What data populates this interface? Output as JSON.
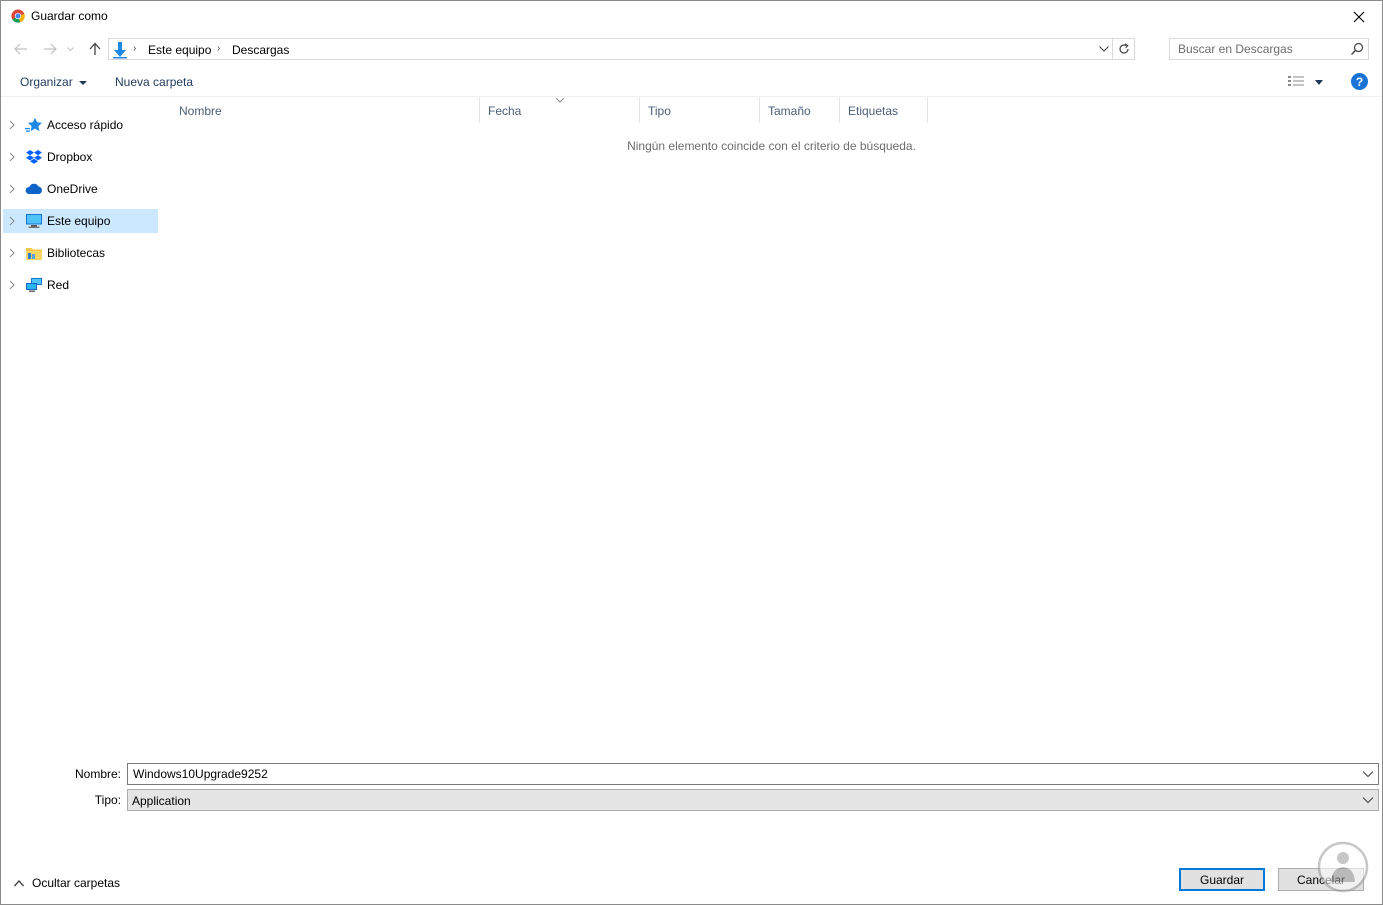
{
  "window": {
    "title": "Guardar como"
  },
  "address_bar": {
    "breadcrumbs": [
      "Este equipo",
      "Descargas"
    ]
  },
  "search": {
    "placeholder": "Buscar en Descargas"
  },
  "toolbar": {
    "organize_label": "Organizar",
    "new_folder_label": "Nueva carpeta"
  },
  "sidebar": {
    "items": [
      {
        "label": "Acceso rápido",
        "icon": "star-icon",
        "selected": false
      },
      {
        "label": "Dropbox",
        "icon": "dropbox-icon",
        "selected": false
      },
      {
        "label": "OneDrive",
        "icon": "cloud-icon",
        "selected": false
      },
      {
        "label": "Este equipo",
        "icon": "computer-icon",
        "selected": true
      },
      {
        "label": "Bibliotecas",
        "icon": "library-folder-icon",
        "selected": false
      },
      {
        "label": "Red",
        "icon": "network-icon",
        "selected": false
      }
    ]
  },
  "file_list": {
    "columns": [
      "Nombre",
      "Fecha",
      "Tipo",
      "Tamaño",
      "Etiquetas"
    ],
    "empty_message": "Ningún elemento coincide con el criterio de búsqueda."
  },
  "form": {
    "name_label": "Nombre:",
    "name_value": "Windows10Upgrade9252",
    "type_label": "Tipo:",
    "type_value": "Application"
  },
  "footer": {
    "hide_folders_label": "Ocultar carpetas",
    "save_label": "Guardar",
    "cancel_label": "Cancelar"
  },
  "colors": {
    "selection": "#cce8ff",
    "link_blue": "#1e395b",
    "accent": "#0078d7",
    "help_blue": "#1a74d6"
  }
}
